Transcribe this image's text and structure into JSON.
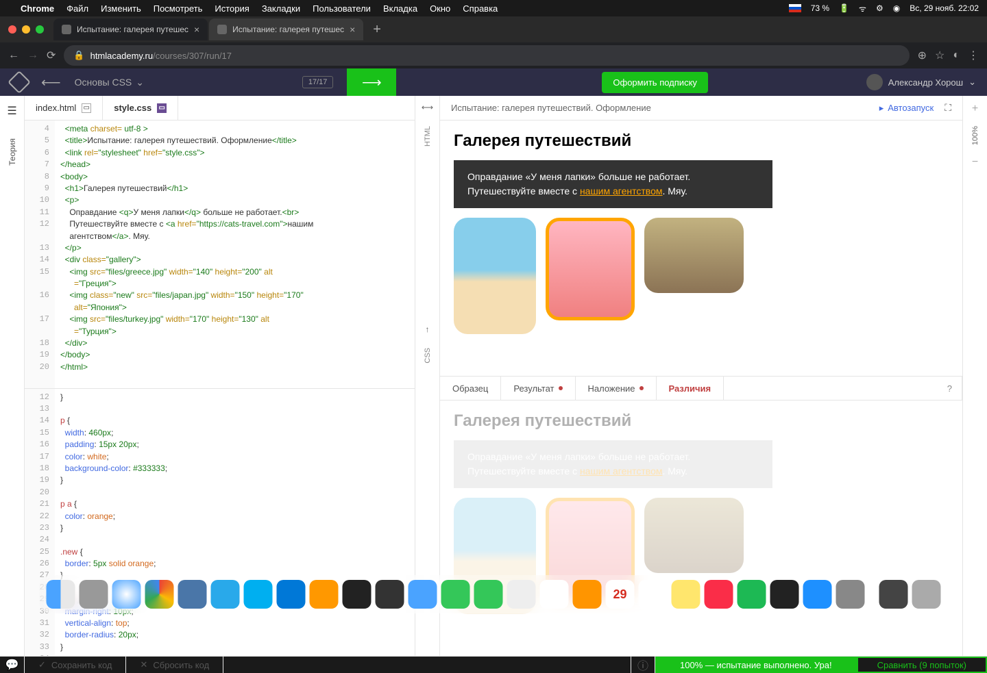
{
  "menubar": {
    "app": "Chrome",
    "items": [
      "Файл",
      "Изменить",
      "Посмотреть",
      "История",
      "Закладки",
      "Пользователи",
      "Вкладка",
      "Окно",
      "Справка"
    ],
    "battery": "73 %",
    "datetime": "Вс, 29 нояб.  22:02"
  },
  "tabs": [
    {
      "title": "Испытание: галерея путешес",
      "active": true
    },
    {
      "title": "Испытание: галерея путешес",
      "active": false
    }
  ],
  "url": {
    "host": "htmlacademy.ru",
    "path": "/courses/307/run/17"
  },
  "header": {
    "course": "Основы CSS",
    "progress": "17/17",
    "subscribe": "Оформить подписку",
    "user": "Александр Хорош"
  },
  "files": {
    "html": "index.html",
    "css": "style.css"
  },
  "preview": {
    "breadcrumb": "Испытание: галерея путешествий. Оформление",
    "autorun": "Автозапуск",
    "h1": "Галерея путешествий",
    "banner1": "Оправдание «У меня лапки» больше не работает.",
    "banner2a": "Путешествуйте вместе с ",
    "banner2link": "нашим агентством",
    "banner2b": ". Мяу."
  },
  "ptabs": {
    "sample": "Образец",
    "result": "Результат",
    "overlay": "Наложение",
    "diff": "Различия"
  },
  "footer": {
    "save": "Сохранить код",
    "reset": "Сбросить код",
    "success": "100% — испытание выполнено. Ура!",
    "compare": "Сравнить (9 попыток)"
  },
  "sidebar": {
    "theory": "Теория"
  },
  "rail": {
    "pct": "100%",
    "html": "HTML",
    "css": "CSS"
  },
  "code_html_gutter": "4\n5\n6\n7\n8\n9\n10\n11\n12\n\n13\n14\n15\n\n16\n\n17\n\n18\n19\n20",
  "code_css_gutter": "12\n13\n14\n15\n16\n17\n18\n19\n20\n21\n22\n23\n24\n25\n26\n27\n28\n29\n30\n31\n32\n33\n34"
}
